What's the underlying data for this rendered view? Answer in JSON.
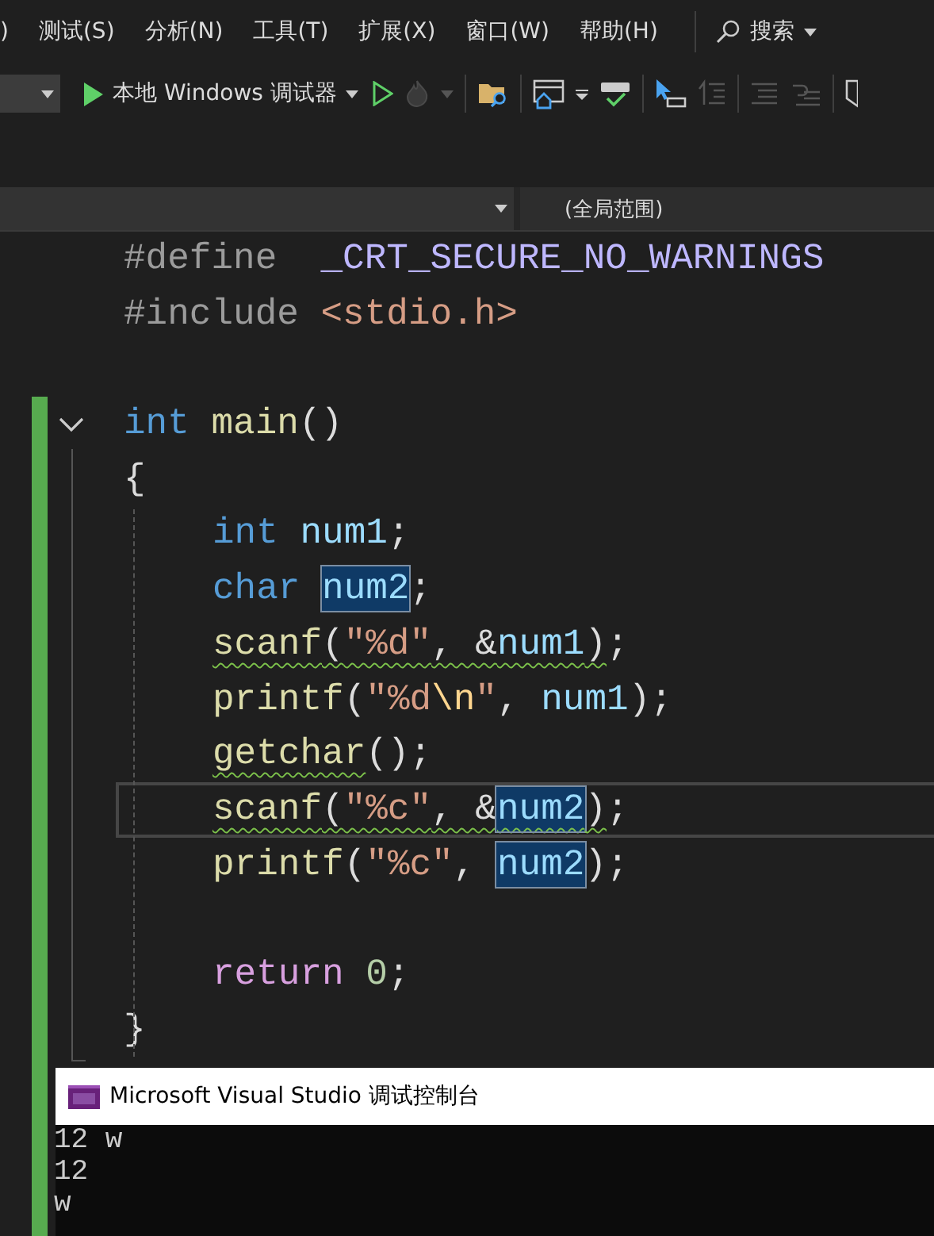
{
  "menu_bar": {
    "items": [
      {
        "label": ")"
      },
      {
        "label": "测试(S)"
      },
      {
        "label": "分析(N)"
      },
      {
        "label": "工具(T)"
      },
      {
        "label": "扩展(X)"
      },
      {
        "label": "窗口(W)"
      },
      {
        "label": "帮助(H)"
      }
    ],
    "search": {
      "label": "搜索"
    }
  },
  "toolbar": {
    "debugger": {
      "label": "本地 Windows 调试器"
    }
  },
  "navigation_bar": {
    "scope": "(全局范围)"
  },
  "code_lines": [
    {
      "kind": "code",
      "indented": false,
      "changed": false,
      "current": false,
      "tokens": [
        {
          "text": "#define  ",
          "kind": "preproc",
          "squiggle": false,
          "highlighted": false
        },
        {
          "text": "_CRT_SECURE_NO_WARNINGS",
          "kind": "macro",
          "squiggle": false,
          "highlighted": false
        }
      ]
    },
    {
      "kind": "code",
      "indented": false,
      "changed": false,
      "current": false,
      "tokens": [
        {
          "text": "#include ",
          "kind": "preproc",
          "squiggle": false,
          "highlighted": false
        },
        {
          "text": "<stdio.h>",
          "kind": "string",
          "squiggle": false,
          "highlighted": false
        }
      ]
    },
    {
      "kind": "blank",
      "changed": false
    },
    {
      "kind": "code",
      "indented": false,
      "changed": true,
      "current": false,
      "fold": {
        "expanded": true
      },
      "tokens": [
        {
          "text": "int ",
          "kind": "keyword",
          "squiggle": false,
          "highlighted": false
        },
        {
          "text": "main",
          "kind": "function",
          "squiggle": false,
          "highlighted": false
        },
        {
          "text": "()",
          "kind": "plain",
          "squiggle": false,
          "highlighted": false
        }
      ]
    },
    {
      "kind": "code",
      "indented": false,
      "changed": true,
      "current": false,
      "tokens": [
        {
          "text": "{",
          "kind": "plain",
          "squiggle": false,
          "highlighted": false
        }
      ]
    },
    {
      "kind": "code",
      "indented": true,
      "changed": true,
      "current": false,
      "tokens": [
        {
          "text": "int ",
          "kind": "keyword",
          "squiggle": false,
          "highlighted": false
        },
        {
          "text": "num1",
          "kind": "variable",
          "squiggle": false,
          "highlighted": false
        },
        {
          "text": ";",
          "kind": "plain",
          "squiggle": false,
          "highlighted": false
        }
      ]
    },
    {
      "kind": "code",
      "indented": true,
      "changed": true,
      "current": false,
      "tokens": [
        {
          "text": "char ",
          "kind": "keyword",
          "squiggle": false,
          "highlighted": false
        },
        {
          "text": "num2",
          "kind": "variable",
          "squiggle": false,
          "highlighted": true
        },
        {
          "text": ";",
          "kind": "plain",
          "squiggle": false,
          "highlighted": false
        }
      ]
    },
    {
      "kind": "code",
      "indented": true,
      "changed": true,
      "current": false,
      "tokens": [
        {
          "text": "scanf",
          "kind": "function",
          "squiggle": true,
          "highlighted": false
        },
        {
          "text": "(",
          "kind": "plain",
          "squiggle": true,
          "highlighted": false
        },
        {
          "text": "\"%d\"",
          "kind": "string",
          "squiggle": true,
          "highlighted": false
        },
        {
          "text": ", &",
          "kind": "plain",
          "squiggle": true,
          "highlighted": false
        },
        {
          "text": "num1",
          "kind": "variable",
          "squiggle": true,
          "highlighted": false
        },
        {
          "text": ")",
          "kind": "plain",
          "squiggle": true,
          "highlighted": false
        },
        {
          "text": ";",
          "kind": "plain",
          "squiggle": false,
          "highlighted": false
        }
      ]
    },
    {
      "kind": "code",
      "indented": true,
      "changed": true,
      "current": false,
      "tokens": [
        {
          "text": "printf",
          "kind": "function",
          "squiggle": false,
          "highlighted": false
        },
        {
          "text": "(",
          "kind": "plain",
          "squiggle": false,
          "highlighted": false
        },
        {
          "text": "\"%d",
          "kind": "string",
          "squiggle": false,
          "highlighted": false
        },
        {
          "text": "\\n",
          "kind": "escape",
          "squiggle": false,
          "highlighted": false
        },
        {
          "text": "\"",
          "kind": "string",
          "squiggle": false,
          "highlighted": false
        },
        {
          "text": ", ",
          "kind": "plain",
          "squiggle": false,
          "highlighted": false
        },
        {
          "text": "num1",
          "kind": "variable",
          "squiggle": false,
          "highlighted": false
        },
        {
          "text": ");",
          "kind": "plain",
          "squiggle": false,
          "highlighted": false
        }
      ]
    },
    {
      "kind": "code",
      "indented": true,
      "changed": true,
      "current": false,
      "tokens": [
        {
          "text": "getchar",
          "kind": "function",
          "squiggle": true,
          "highlighted": false
        },
        {
          "text": "();",
          "kind": "plain",
          "squiggle": false,
          "highlighted": false
        }
      ]
    },
    {
      "kind": "code",
      "indented": true,
      "changed": true,
      "current": true,
      "tokens": [
        {
          "text": "scanf",
          "kind": "function",
          "squiggle": true,
          "highlighted": false
        },
        {
          "text": "(",
          "kind": "plain",
          "squiggle": true,
          "highlighted": false
        },
        {
          "text": "\"%c\"",
          "kind": "string",
          "squiggle": true,
          "highlighted": false
        },
        {
          "text": ", &",
          "kind": "plain",
          "squiggle": true,
          "highlighted": false
        },
        {
          "text": "num2",
          "kind": "variable",
          "squiggle": true,
          "highlighted": true
        },
        {
          "text": ")",
          "kind": "plain",
          "squiggle": true,
          "highlighted": false
        },
        {
          "text": ";",
          "kind": "plain",
          "squiggle": false,
          "highlighted": false
        }
      ]
    },
    {
      "kind": "code",
      "indented": true,
      "changed": true,
      "current": false,
      "tokens": [
        {
          "text": "printf",
          "kind": "function",
          "squiggle": false,
          "highlighted": false
        },
        {
          "text": "(",
          "kind": "plain",
          "squiggle": false,
          "highlighted": false
        },
        {
          "text": "\"%c\"",
          "kind": "string",
          "squiggle": false,
          "highlighted": false
        },
        {
          "text": ", ",
          "kind": "plain",
          "squiggle": false,
          "highlighted": false
        },
        {
          "text": "num2",
          "kind": "variable",
          "squiggle": false,
          "highlighted": true
        },
        {
          "text": ");",
          "kind": "plain",
          "squiggle": false,
          "highlighted": false
        }
      ]
    },
    {
      "kind": "blank",
      "changed": true
    },
    {
      "kind": "code",
      "indented": true,
      "changed": true,
      "current": false,
      "tokens": [
        {
          "text": "return ",
          "kind": "control",
          "squiggle": false,
          "highlighted": false
        },
        {
          "text": "0",
          "kind": "number",
          "squiggle": false,
          "highlighted": false
        },
        {
          "text": ";",
          "kind": "plain",
          "squiggle": false,
          "highlighted": false
        }
      ]
    },
    {
      "kind": "code",
      "indented": false,
      "changed": true,
      "current": false,
      "tokens": [
        {
          "text": "}",
          "kind": "plain",
          "squiggle": false,
          "highlighted": false
        }
      ]
    }
  ],
  "console": {
    "title": "Microsoft Visual Studio 调试控制台",
    "lines": [
      "12 w",
      "12",
      "w"
    ]
  }
}
